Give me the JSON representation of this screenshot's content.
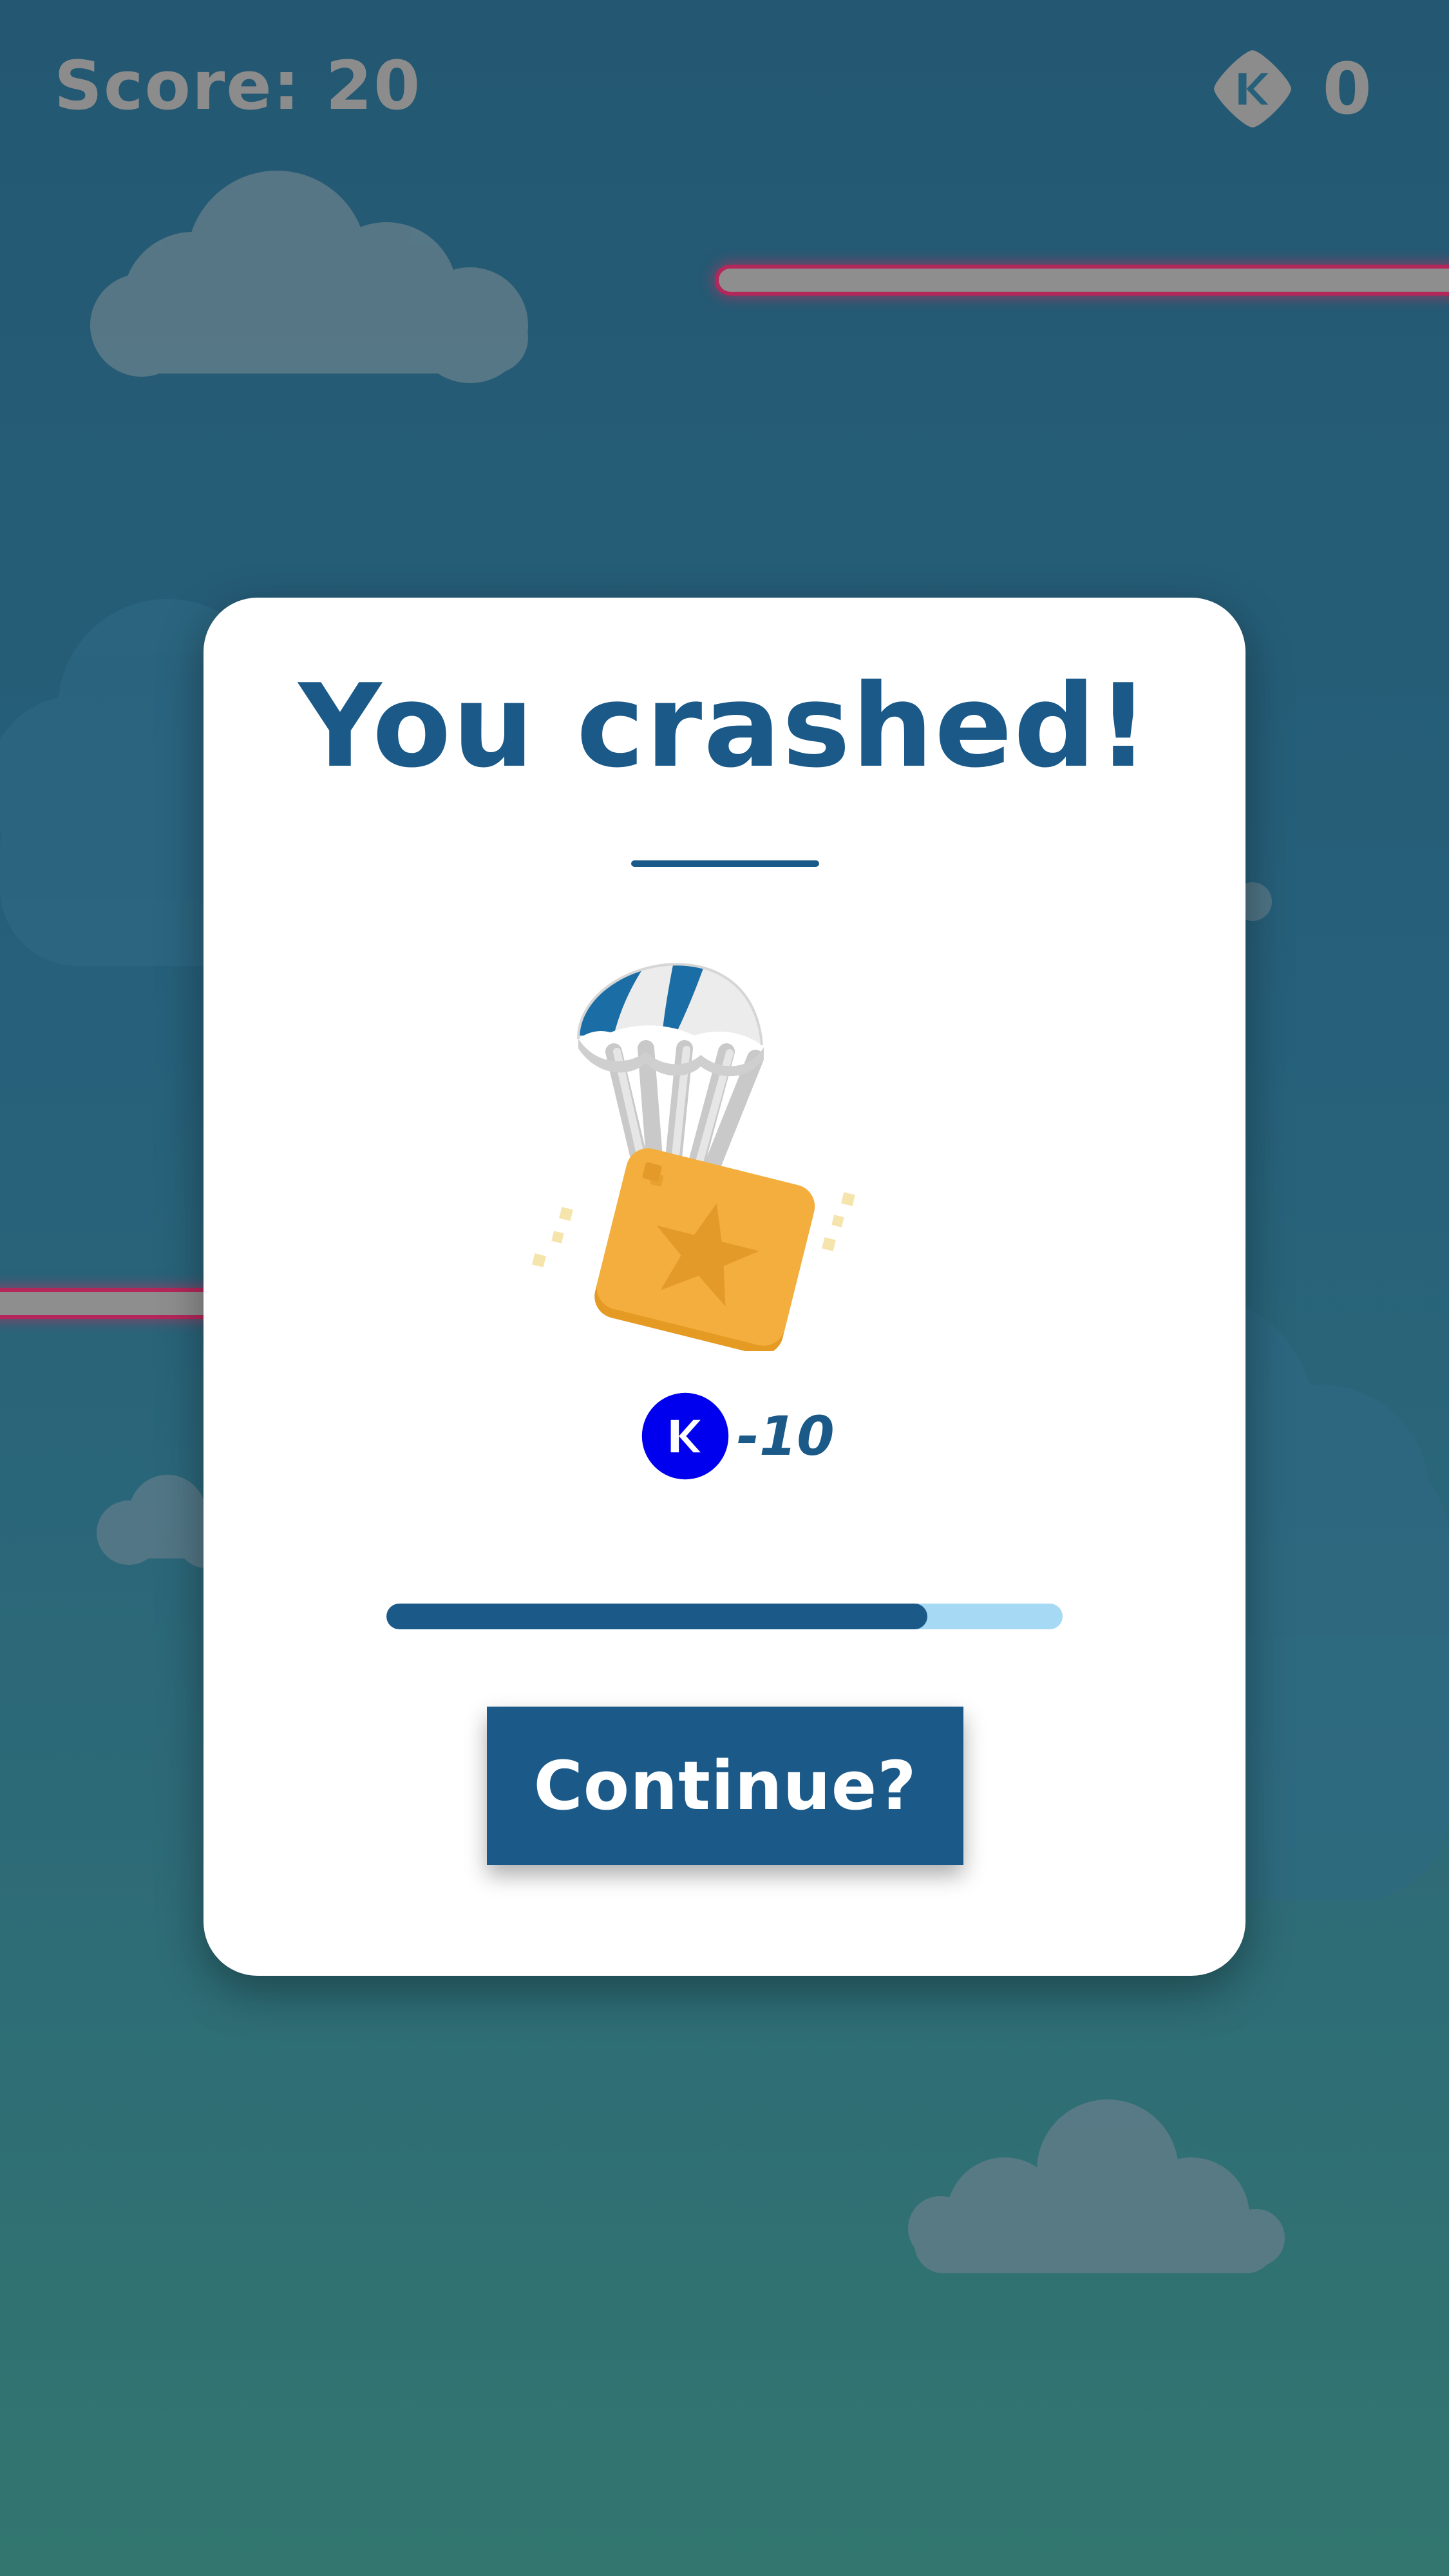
{
  "hud": {
    "score_text": "Score: 20",
    "coin_icon": "coin-icon",
    "coin_count": "0"
  },
  "dialog": {
    "title": "You crashed!",
    "illustration": "parachute-crate",
    "penalty_icon": "coin-icon",
    "penalty_value": "-10",
    "progress": 0.8,
    "continue_label": "Continue?"
  },
  "colors": {
    "primary": "#1b5a88",
    "progress_track": "#a6daf4",
    "coin_blue": "#0000ee",
    "crate": "#f3ae3d",
    "laser_glow": "#b3275a",
    "sky_top": "#245872",
    "sky_bottom": "#32766f"
  }
}
